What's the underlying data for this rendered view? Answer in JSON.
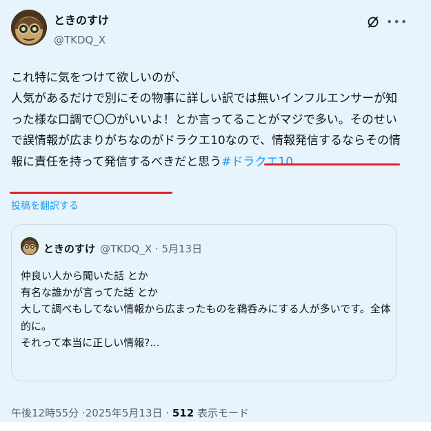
{
  "author": {
    "name": "ときのすけ",
    "handle": "@TKDQ_X"
  },
  "tweet": {
    "lines": [
      "これ特に気をつけて欲しいのが、",
      "人気があるだけで別にその物事に詳しい訳では無いインフルエンサーが知",
      "った様な口調で〇〇がいいよ！とか言ってることがマジで多い。そのせい",
      "で誤情報が広まりがちなのがドラクエ10なので、情報発信するならその情",
      "報に責任を持って発信するべきだと思う"
    ],
    "hashtag": "#ドラクエ10",
    "translate_label": "投稿を翻訳する"
  },
  "quote": {
    "name": "ときのすけ",
    "meta": "@TKDQ_X · 5月13日",
    "lines": [
      "仲良い人から聞いた話 とか",
      "有名な誰かが言ってた話 とか",
      "大して調べもしてない情報から広まったものを鵜呑みにする人が多いです。全体",
      "的に。",
      "それって本当に正しい情報?..."
    ]
  },
  "footer": {
    "time": "午後12時55分 ·",
    "date": "2025年5月13日 ·",
    "views": "512",
    "views_label": "表示モード"
  },
  "colors": {
    "accent": "#1d9bf0",
    "highlight_underline": "#e0202a",
    "background_tint": "#e8f4fb"
  },
  "icons": [
    "grok-icon",
    "more-icon"
  ]
}
